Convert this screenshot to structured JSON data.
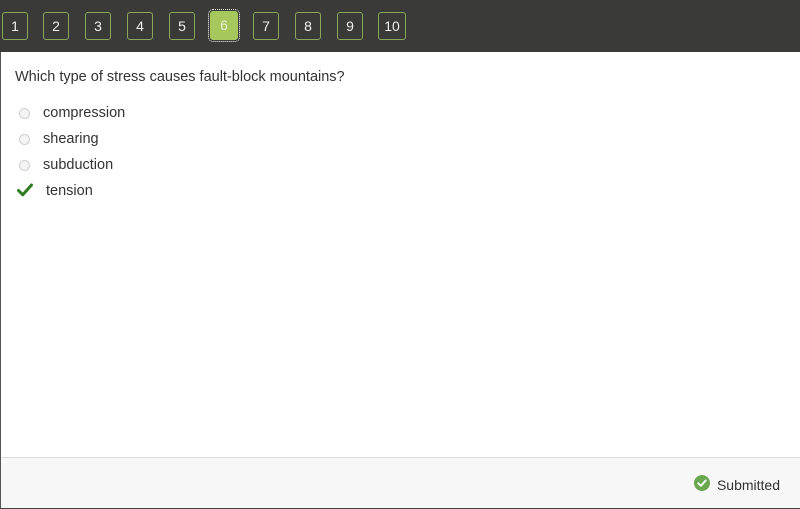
{
  "question_nav": {
    "items": [
      "1",
      "2",
      "3",
      "4",
      "5",
      "6",
      "7",
      "8",
      "9",
      "10"
    ],
    "active_index": 5
  },
  "question": {
    "text": "Which type of stress causes fault-block mountains?",
    "options": [
      {
        "label": "compression",
        "state": "unselected"
      },
      {
        "label": "shearing",
        "state": "unselected"
      },
      {
        "label": "subduction",
        "state": "unselected"
      },
      {
        "label": "tension",
        "state": "correct"
      }
    ]
  },
  "footer": {
    "status_label": "Submitted",
    "status_icon": "check-circle-icon"
  },
  "colors": {
    "topbar": "#3a3a39",
    "accent_green": "#a6c75b",
    "check_green": "#2e7d1e",
    "submitted_green": "#6aa84f"
  }
}
